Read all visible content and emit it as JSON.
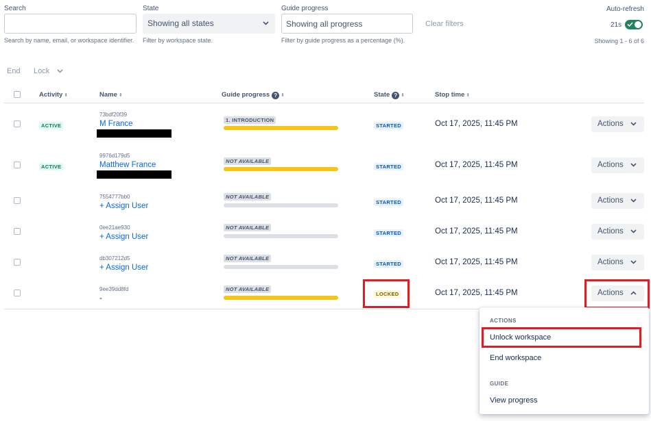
{
  "filters": {
    "search": {
      "label": "Search",
      "value": "",
      "help": "Search by name, email, or workspace identifier."
    },
    "state": {
      "label": "State",
      "value": "Showing all states",
      "help": "Filter by workspace state."
    },
    "guide": {
      "label": "Guide progress",
      "value": "Showing all progress",
      "help": "Filter by guide progress as a percentage (%)."
    },
    "clear_label": "Clear filters",
    "auto_refresh_label": "Auto-refresh",
    "timer": "21s",
    "auto_refresh_on": true,
    "count_text": "Showing 1 - 6 of 6"
  },
  "bulk_actions": {
    "end_label": "End",
    "lock_label": "Lock"
  },
  "table": {
    "headers": {
      "activity": "Activity",
      "name": "Name",
      "guide_progress": "Guide progress",
      "state": "State",
      "stop_time": "Stop time"
    },
    "rows": [
      {
        "activity": "ACTIVE",
        "id": "73bdf20f39",
        "name": "M France",
        "guide": "1. INTRODUCTION",
        "progress": 1.0,
        "state": "STARTED",
        "stop_time": "Oct 17, 2025, 11:45 PM",
        "actions": "Actions"
      },
      {
        "activity": "ACTIVE",
        "id": "9976d179d5",
        "name": "Matthew France",
        "guide": "NOT AVAILABLE",
        "progress": 1.0,
        "state": "STARTED",
        "stop_time": "Oct 17, 2025, 11:45 PM",
        "actions": "Actions"
      },
      {
        "activity": "",
        "id": "7554777bb0",
        "name": "+ Assign User",
        "guide": "NOT AVAILABLE",
        "progress": 0.0,
        "state": "STARTED",
        "stop_time": "Oct 17, 2025, 11:45 PM",
        "actions": "Actions"
      },
      {
        "activity": "",
        "id": "0ee21ae930",
        "name": "+ Assign User",
        "guide": "NOT AVAILABLE",
        "progress": 0.0,
        "state": "STARTED",
        "stop_time": "Oct 17, 2025, 11:45 PM",
        "actions": "Actions"
      },
      {
        "activity": "",
        "id": "db307212d5",
        "name": "+ Assign User",
        "guide": "NOT AVAILABLE",
        "progress": 0.0,
        "state": "STARTED",
        "stop_time": "Oct 17, 2025, 11:45 PM",
        "actions": "Actions"
      },
      {
        "activity": "",
        "id": "9ee39dd8fd",
        "name": "-",
        "guide": "NOT AVAILABLE",
        "progress": 1.0,
        "state": "LOCKED",
        "stop_time": "Oct 17, 2025, 11:45 PM",
        "actions": "Actions"
      }
    ]
  },
  "menu": {
    "actions_heading": "ACTIONS",
    "unlock": "Unlock workspace",
    "end": "End workspace",
    "guide_heading": "GUIDE",
    "view_progress": "View progress"
  },
  "colors": {
    "highlight": "#e01b24",
    "link": "#0c66e4",
    "progress_fill": "#f5c518",
    "toggle_on": "#1f845a"
  },
  "icons": [
    "chevron-down-icon",
    "chevron-up-icon",
    "question-circle-icon",
    "checkmark-icon",
    "sort-arrow-icon"
  ]
}
